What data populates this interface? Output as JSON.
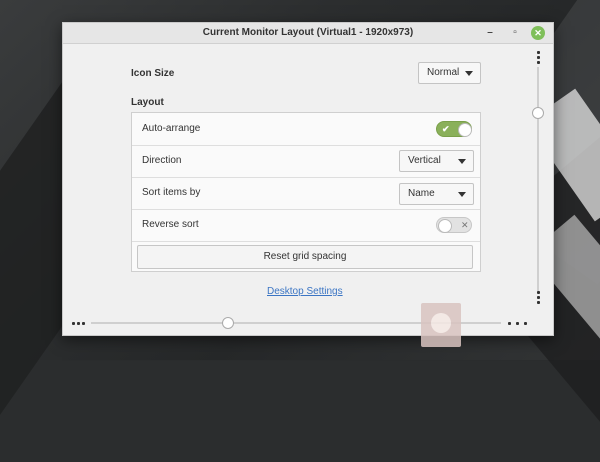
{
  "window": {
    "title": "Current Monitor Layout (Virtual1 - 1920x973)",
    "minimize_glyph": "–",
    "maximize_glyph": "▫",
    "close_glyph": "✕"
  },
  "icon_size": {
    "label": "Icon Size",
    "value": "Normal"
  },
  "layout": {
    "heading": "Layout",
    "auto_arrange": {
      "label": "Auto-arrange",
      "state": true
    },
    "direction": {
      "label": "Direction",
      "value": "Vertical"
    },
    "sort_items_by": {
      "label": "Sort items by",
      "value": "Name"
    },
    "reverse_sort": {
      "label": "Reverse sort",
      "state": false
    },
    "reset_button": "Reset grid spacing"
  },
  "link": "Desktop Settings",
  "icons": {
    "on_glyph": "✔",
    "off_glyph": "✕"
  },
  "colors": {
    "accent": "#8ab05a",
    "close_button": "#7fbf5a",
    "link": "#3b75c4"
  }
}
